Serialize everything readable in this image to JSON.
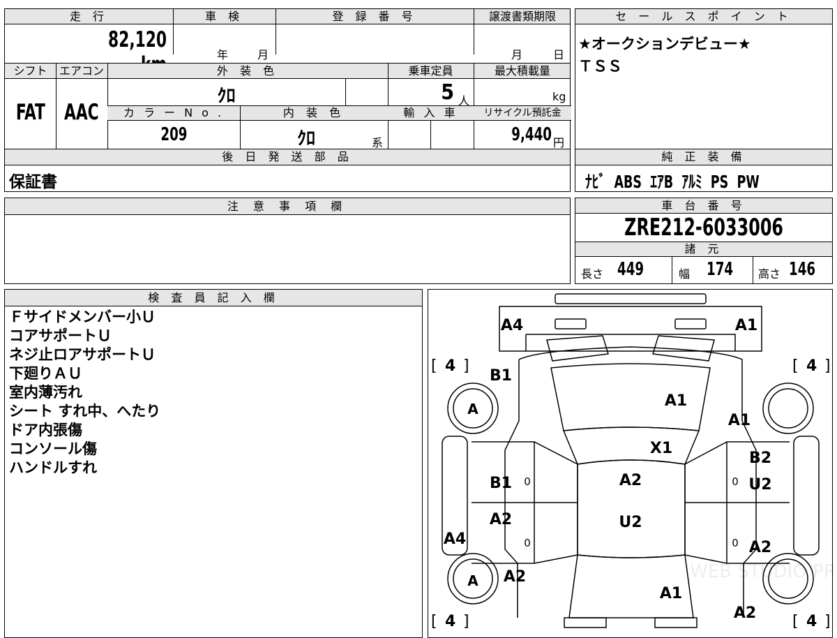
{
  "top_info": {
    "headers": {
      "mileage": "走 行",
      "inspection": "車 検",
      "registration_no": "登 録 番 号",
      "transfer_deadline": "譲渡書類期限",
      "shift": "シフト",
      "aircon": "エアコン",
      "exterior_color": "外 装 色",
      "capacity": "乗車定員",
      "max_load": "最大積載量",
      "color_no": "カ ラ ー N o .",
      "interior_color": "内 装 色",
      "import": "輸 入 車",
      "recycle_fee": "リサイクル預託金"
    },
    "mileage_value": "82,120",
    "mileage_unit": "km",
    "inspection_year_unit": "年",
    "inspection_month_unit": "月",
    "deadline_month_unit": "月",
    "deadline_day_unit": "日",
    "shift_value": "FAT",
    "aircon_value": "AAC",
    "exterior_color_value": "ｸﾛ",
    "capacity_value": "5",
    "capacity_unit": "人",
    "max_load_unit": "kg",
    "color_no_value": "209",
    "interior_color_value": "ｸﾛ",
    "interior_color_suffix": "系",
    "recycle_fee_value": "9,440",
    "recycle_fee_unit": "円"
  },
  "deferred_parts": {
    "header": "後 日 発 送 部 品",
    "value": "保証書"
  },
  "sales_point": {
    "header": "セ ー ル ス ポ イ ン ト",
    "line1": "★オークションデビュー★",
    "line2": "ＴＳＳ"
  },
  "equipment": {
    "header": "純 正 装 備",
    "value": "ﾅﾋﾞ  ABS  ｴｱB  ｱﾙﾐ  PS  PW"
  },
  "notes": {
    "header": "注 意 事 項 欄",
    "value": ""
  },
  "chassis": {
    "header": "車 台 番 号",
    "value": "ZRE212-6033006"
  },
  "specs": {
    "header": "諸 元",
    "length_label": "長さ",
    "length_value": "449",
    "width_label": "幅",
    "width_value": "174",
    "height_label": "高さ",
    "height_value": "146"
  },
  "inspector": {
    "header": "検 査 員 記 入 欄",
    "lines": [
      "Ｆサイドメンバー小Ｕ",
      "コアサポートＵ",
      "ネジ止ロアサポートＵ",
      "下廻りＡＵ",
      "室内薄汚れ",
      "シート すれ中、へたり",
      "ドア内張傷",
      "コンソール傷",
      "ハンドルすれ"
    ]
  },
  "diagram": {
    "tire_depth_fl": "4",
    "tire_depth_fr": "4",
    "tire_depth_rl": "4",
    "tire_depth_rr": "4",
    "wheel_left_front": "A",
    "wheel_left_rear": "A",
    "marks": {
      "front_bumper_left": "A4",
      "front_bumper_right": "A1",
      "left_front_fender": "B1",
      "hood": "A1",
      "right_front_fender": "A1",
      "windshield": "X1",
      "right_front_door_top": "B2",
      "left_front_door": "B1",
      "roof": "A2",
      "right_front_door": "U2",
      "left_rear_door": "A2",
      "roof_rear": "U2",
      "left_side_sill": "A4",
      "right_rear_door": "A2",
      "left_rear_fender": "A2",
      "trunk": "A1",
      "right_rear_fender": "A2"
    },
    "door_marks": "0",
    "watermark": "WEB STUDIO PRO"
  }
}
